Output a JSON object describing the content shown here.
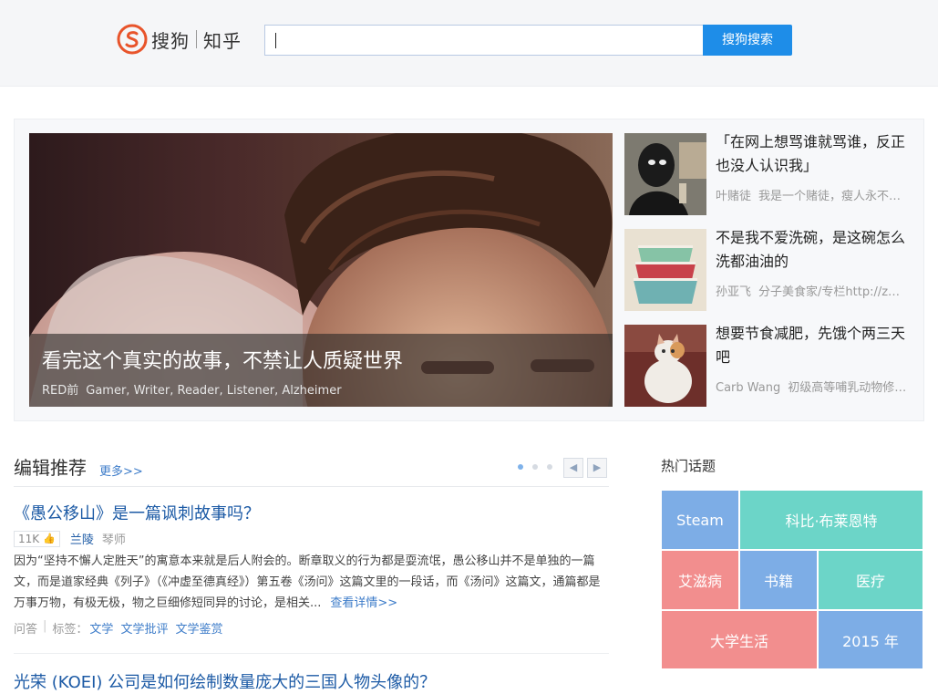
{
  "header": {
    "logo_sogou": "搜狗",
    "logo_zhihu": "知乎",
    "search_placeholder": "",
    "search_button": "搜狗搜索"
  },
  "hero": {
    "title": "看完这个真实的故事，不禁让人质疑世界",
    "author": "RED前",
    "author_bio": "Gamer, Writer, Reader, Listener, Alzheimer"
  },
  "side_articles": [
    {
      "title": "「在网上想骂谁就骂谁，反正也没人认识我」",
      "author": "叶赌徒",
      "bio": "我是一个赌徒，瘦人永不…",
      "thumb": "anonymous-figure-image"
    },
    {
      "title": "不是我不爱洗碗，是这碗怎么洗都油油的",
      "author": "孙亚飞",
      "bio": "分子美食家/专栏http://z…",
      "thumb": "stacked-bowls-image"
    },
    {
      "title": "想要节食减肥，先饿个两三天吧",
      "author": "Carb Wang",
      "bio": "初级高等哺乳动物修…",
      "thumb": "fat-cat-image"
    }
  ],
  "editor": {
    "title": "编辑推荐",
    "more": "更多>>",
    "prev": "◀",
    "next": "▶"
  },
  "questions": [
    {
      "title": "《愚公移山》是一篇讽刺故事吗？",
      "votes": "11K",
      "author": "兰陵",
      "author_bio": "琴师",
      "excerpt": "因为“坚持不懈人定胜天”的寓意本来就是后人附会的。断章取义的行为都是耍流氓，愚公移山并不是单独的一篇文，而是道家经典《列子》（《冲虚至德真经》）第五卷《汤问》这篇文里的一段话，而《汤问》这篇文，通篇都是万事万物，有极无极，物之巨细修短同异的讨论，是相关...",
      "read_more": "查看详情>>",
      "type": "问答",
      "tags_label": "标签：",
      "tags": [
        "文学",
        "文学批评",
        "文学鉴赏"
      ]
    },
    {
      "title": "光荣 (KOEI) 公司是如何绘制数量庞大的三国人物头像的？"
    }
  ],
  "hot_topics": {
    "title": "热门话题",
    "tiles": [
      {
        "label": "Steam",
        "color": "#7dade6"
      },
      {
        "label": "科比·布莱恩特",
        "color": "#6cd5c8"
      },
      {
        "label": "艾滋病",
        "color": "#f28e8e"
      },
      {
        "label": "书籍",
        "color": "#7dade6"
      },
      {
        "label": "医疗",
        "color": "#6cd5c8"
      },
      {
        "label": "大学生活",
        "color": "#f28e8e"
      },
      {
        "label": "2015 年",
        "color": "#7dade6"
      }
    ]
  },
  "colors": {
    "accent_blue": "#1e8de8",
    "link_blue": "#1c5aa5"
  }
}
